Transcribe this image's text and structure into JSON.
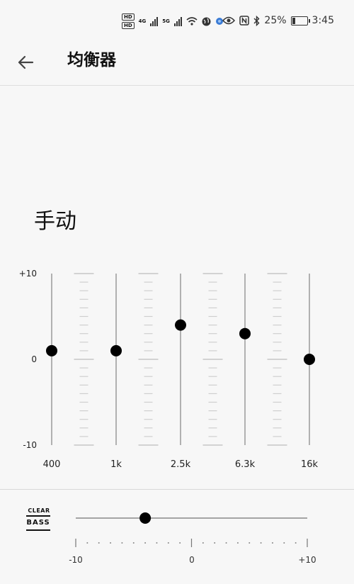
{
  "status_bar": {
    "hd1": "HD",
    "hd2": "HD",
    "net1": "4G",
    "net2": "5G",
    "battery_percent": "25%",
    "battery_level": 0.25,
    "time": "3:45",
    "icons": [
      "hd-icon",
      "signal-icon",
      "wifi-icon",
      "globe-icon",
      "eye-icon",
      "nfc-icon",
      "bluetooth-icon",
      "battery-icon"
    ]
  },
  "header": {
    "title": "均衡器",
    "back_icon": "back-arrow-icon"
  },
  "mode_label": "手动",
  "equalizer": {
    "scale": {
      "max_label": "+10",
      "mid_label": "0",
      "min_label": "-10",
      "min": -10,
      "max": 10
    },
    "bands": [
      {
        "freq": "400",
        "value": 1
      },
      {
        "freq": "1k",
        "value": 1
      },
      {
        "freq": "2.5k",
        "value": 4
      },
      {
        "freq": "6.3k",
        "value": 3
      },
      {
        "freq": "16k",
        "value": 0
      }
    ]
  },
  "clear_bass": {
    "logo_top": "CLEAR",
    "logo_bottom": "BASS",
    "value": -4,
    "min": -10,
    "max": 10,
    "min_label": "-10",
    "mid_label": "0",
    "max_label": "+10"
  }
}
